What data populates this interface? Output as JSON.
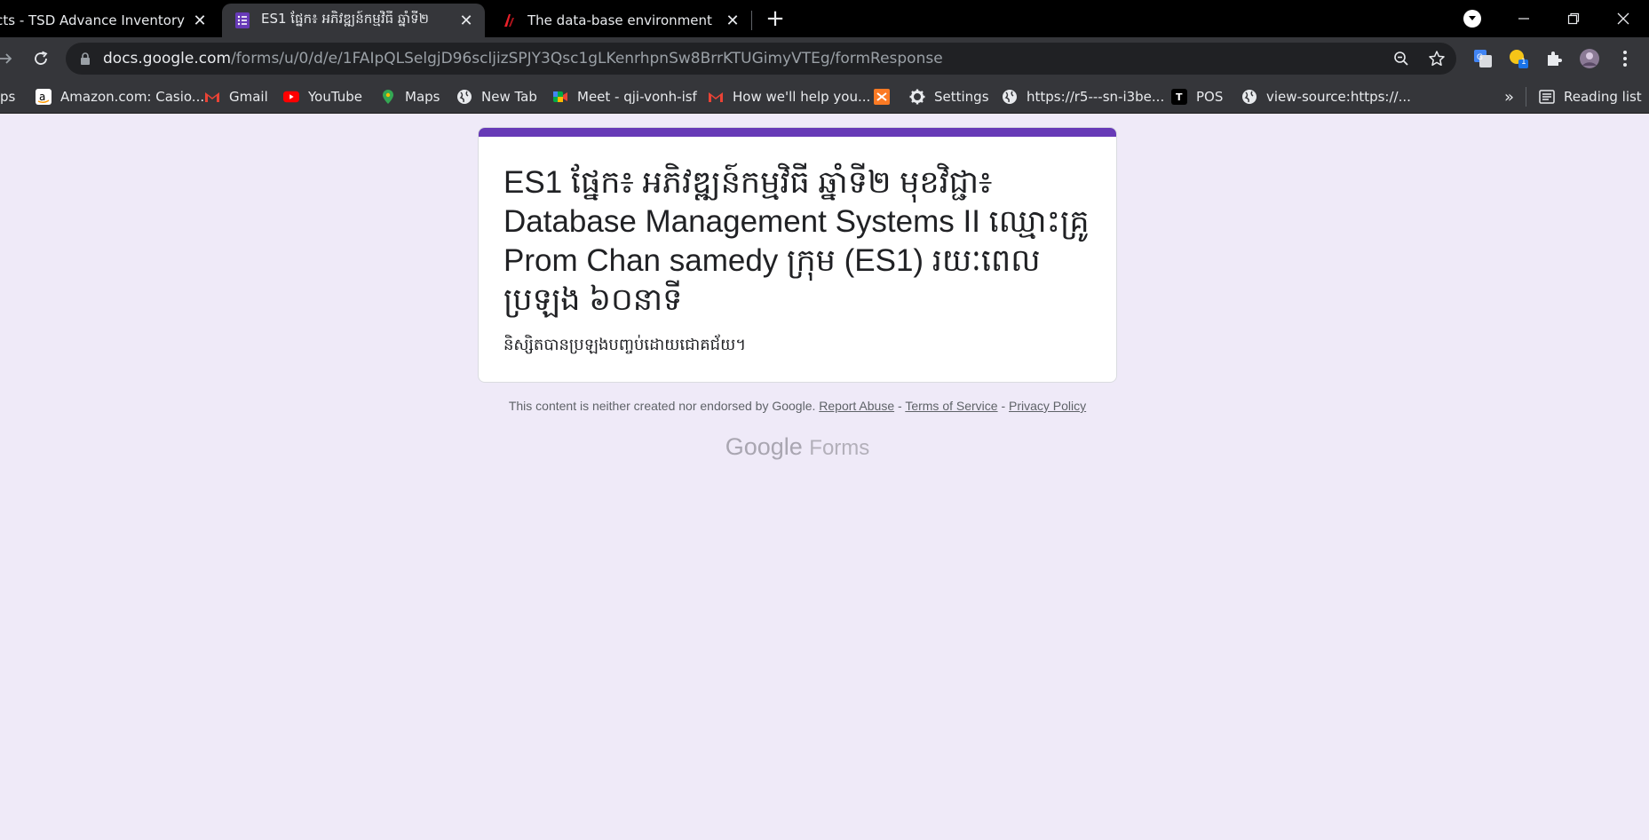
{
  "browser": {
    "tabs": [
      {
        "title": "Products - TSD Advance Inventory",
        "active": false
      },
      {
        "title": "ES1 ផ្នែក៖ អភិវឌ្ឍន៍កម្មវិធី ឆ្នាំទី២",
        "active": true
      },
      {
        "title": "The data-base environment has a",
        "active": false
      }
    ],
    "new_tab_label": "+",
    "close_glyph": "✕",
    "address": {
      "host": "docs.google.com",
      "path": "/forms/u/0/d/e/1FAIpQLSelgjD96scljizSPJY3Qsc1gLKenrhpnSw8BrrKTUGimyVTEg/formResponse"
    },
    "extension_badge": "1",
    "bookmarks": [
      {
        "label": "ps",
        "icon": "apps-icon"
      },
      {
        "label": "Amazon.com: Casio...",
        "icon": "amazon-icon"
      },
      {
        "label": "Gmail",
        "icon": "gmail-icon"
      },
      {
        "label": "YouTube",
        "icon": "youtube-icon"
      },
      {
        "label": "Maps",
        "icon": "maps-icon"
      },
      {
        "label": "New Tab",
        "icon": "globe-icon"
      },
      {
        "label": "Meet - qji-vonh-isf",
        "icon": "meet-icon"
      },
      {
        "label": "How we'll help you...",
        "icon": "gmail-icon"
      },
      {
        "label": "",
        "icon": "xampp-icon"
      },
      {
        "label": "Settings",
        "icon": "gear-icon"
      },
      {
        "label": "https://r5---sn-i3be...",
        "icon": "globe-icon"
      },
      {
        "label": "POS",
        "icon": "pos-icon"
      },
      {
        "label": "view-source:https://...",
        "icon": "globe-icon"
      }
    ],
    "bookmarks_overflow": "»",
    "reading_list": "Reading list"
  },
  "form": {
    "title": "ES1 ផ្នែក៖ អភិវឌ្ឍន៍កម្មវិធី ឆ្នាំទី២ មុខវិជ្ជា៖ Database Management Systems II ឈ្មោះគ្រូ Prom Chan samedy ក្រុម (ES1) រយៈពេលប្រឡង ៦០នាទី",
    "description": "និស្សិតបានប្រឡងបញ្ចប់ដោយជោគជ័យ។",
    "accent_color": "#673ab7"
  },
  "footer": {
    "disclaimer": "This content is neither created nor endorsed by Google.",
    "report_abuse": "Report Abuse",
    "sep": " - ",
    "terms": "Terms of Service",
    "privacy": "Privacy Policy",
    "logo_google": "Google",
    "logo_forms": "Forms"
  }
}
